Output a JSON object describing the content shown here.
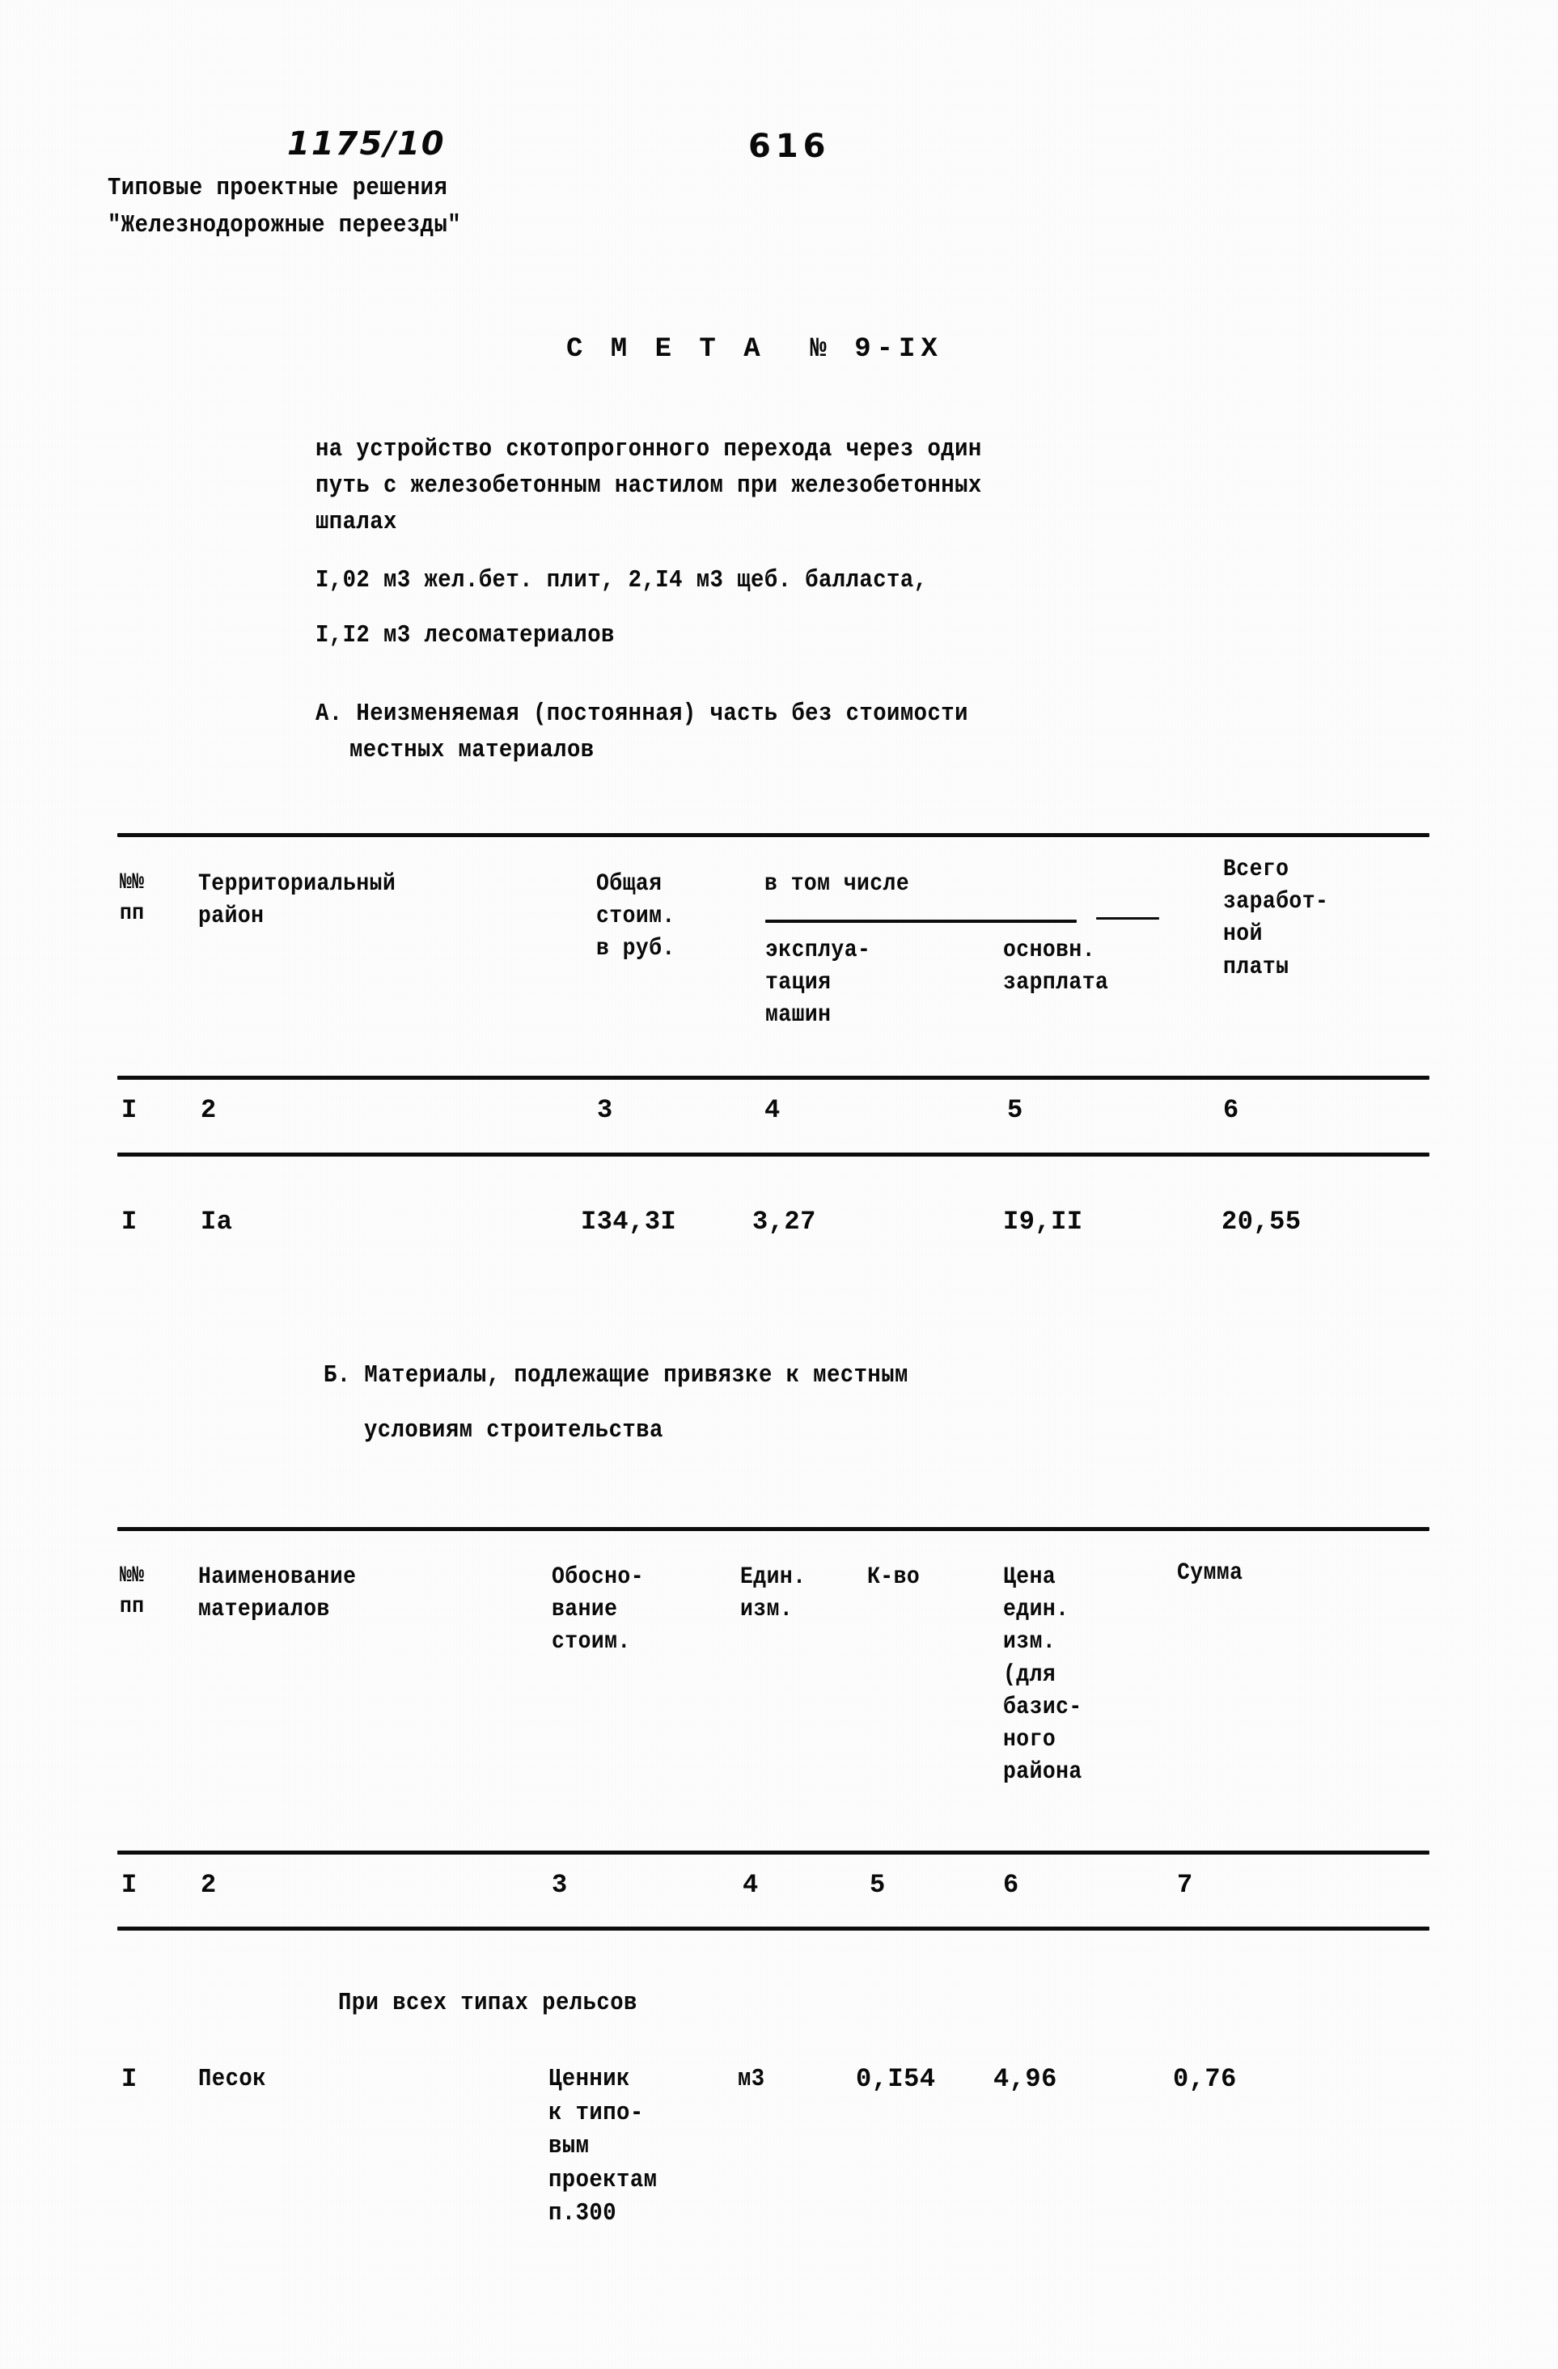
{
  "document": {
    "code": "1175/10",
    "page_number": "616",
    "series_line1": "Типовые проектные решения",
    "series_line2": "\"Железнодорожные переезды\"",
    "title": "С М Е Т А  № 9-IX",
    "subject_lines": [
      "на устройство скотопрогонного перехода через один",
      "путь с железобетонным настилом при железобетонных",
      "шпалах"
    ],
    "quantities_lines": [
      "I,02 м3 жел.бет. плит, 2,I4 м3 щеб. балласта,",
      "I,I2 м3 лесоматериалов"
    ]
  },
  "section_a": {
    "heading_line1": "А. Неизменяемая (постоянная) часть без стоимости",
    "heading_line2": "местных материалов",
    "table": {
      "headers": {
        "no": "№№\nпп",
        "region": "Территориальный\nрайон",
        "total": "Общая\nстоим.\nв руб.",
        "group": "в том числе",
        "machines": "эксплуа-\nтация\nмашин",
        "wages": "основн.\nзарплата",
        "total_wages": "Всего\nзаработ-\nной\nплаты"
      },
      "column_numbers": [
        "I",
        "2",
        "3",
        "4",
        "5",
        "6"
      ],
      "rows": [
        {
          "no": "I",
          "region": "Iа",
          "total": "I34,3I",
          "machines": "3,27",
          "wages": "I9,II",
          "total_wages": "20,55"
        }
      ]
    }
  },
  "section_b": {
    "heading_line1": "Б. Материалы, подлежащие привязке к местным",
    "heading_line2": "условиям строительства",
    "table": {
      "headers": {
        "no": "№№\nпп",
        "name": "Наименование\nматериалов",
        "basis": "Обосно-\nвание\nстоим.",
        "unit": "Един.\nизм.",
        "qty": "К-во",
        "price": "Цена\nедин.\nизм.\n(для\nбазис-\nного\nрайона",
        "sum": "Сумма"
      },
      "column_numbers": [
        "I",
        "2",
        "3",
        "4",
        "5",
        "6",
        "7"
      ],
      "subheading": "При всех типах рельсов",
      "rows": [
        {
          "no": "I",
          "name": "Песок",
          "basis": "Ценник\nк типо-\nвым\nпроектам\nп.300",
          "unit": "м3",
          "qty": "0,I54",
          "price": "4,96",
          "sum": "0,76"
        }
      ]
    }
  }
}
